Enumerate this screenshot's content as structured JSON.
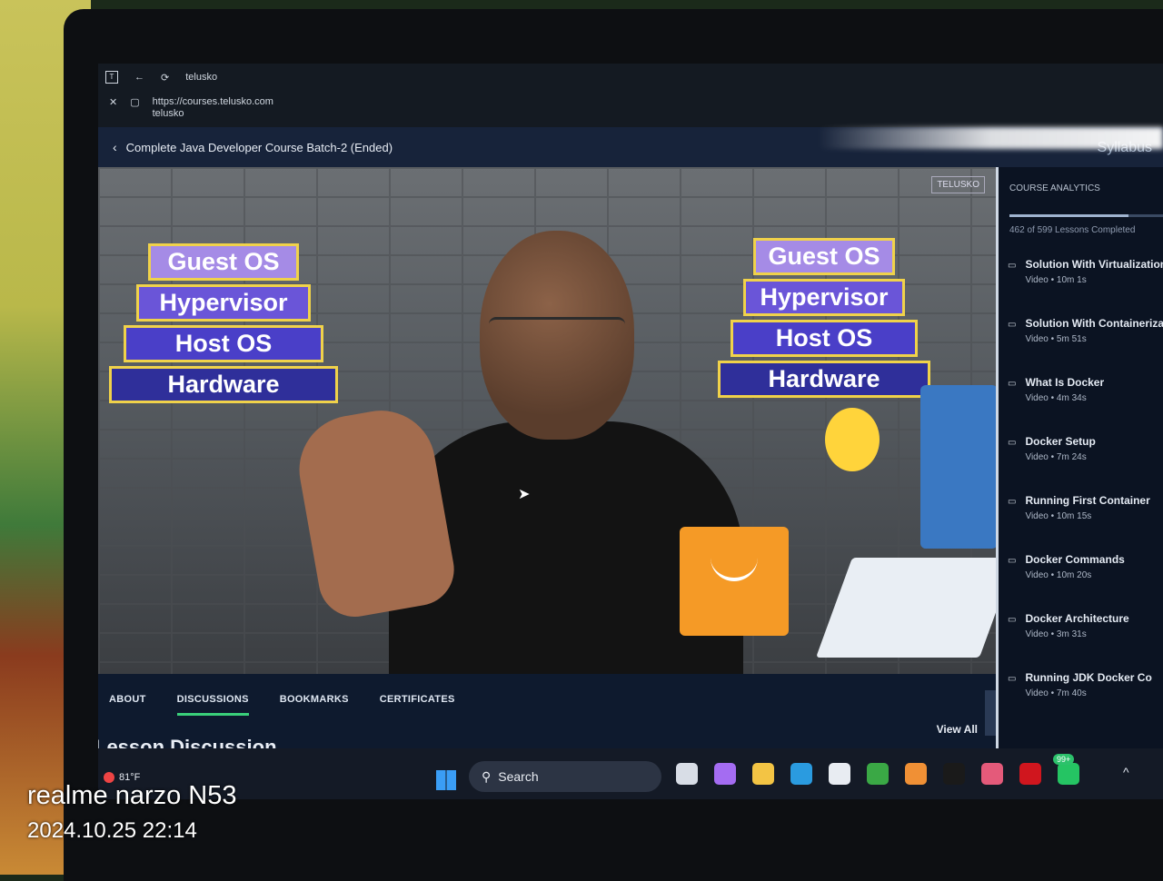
{
  "browser": {
    "tab_title": "telusko",
    "url": "https://courses.telusko.com",
    "site_name": "telusko"
  },
  "course": {
    "title": "Complete Java Developer Course Batch-2 (Ended)",
    "header_right": "Syllabus"
  },
  "video": {
    "watermark": "TELUSKO",
    "left_stack": [
      "Guest OS",
      "Hypervisor",
      "Host OS",
      "Hardware"
    ],
    "right_stack": [
      "Guest OS",
      "Hypervisor",
      "Host OS",
      "Hardware"
    ]
  },
  "tabs": [
    {
      "label": "ABOUT",
      "active": false
    },
    {
      "label": "DISCUSSIONS",
      "active": true
    },
    {
      "label": "BOOKMARKS",
      "active": false
    },
    {
      "label": "CERTIFICATES",
      "active": false
    }
  ],
  "discussion": {
    "title": "Lesson Discussion",
    "view_all": "View All"
  },
  "sidebar": {
    "section_label": "COURSE ANALYTICS",
    "progress_text": "462 of 599 Lessons Completed",
    "progress_fraction": 0.77,
    "lessons": [
      {
        "title": "Solution With Virtualization",
        "meta": "Video • 10m 1s"
      },
      {
        "title": "Solution With Containerizatio",
        "meta": "Video • 5m 51s"
      },
      {
        "title": "What Is Docker",
        "meta": "Video • 4m 34s"
      },
      {
        "title": "Docker Setup",
        "meta": "Video • 7m 24s"
      },
      {
        "title": "Running First Container",
        "meta": "Video • 10m 15s"
      },
      {
        "title": "Docker Commands",
        "meta": "Video • 10m 20s"
      },
      {
        "title": "Docker Architecture",
        "meta": "Video • 3m 31s"
      },
      {
        "title": "Running JDK Docker Co",
        "meta": "Video • 7m 40s"
      }
    ]
  },
  "taskbar": {
    "weather": "81°F",
    "search_label": "Search",
    "badge": "99+",
    "icons": [
      "task-view-icon",
      "copilot-icon",
      "file-explorer-icon",
      "edge-icon",
      "store-icon",
      "xbox-icon",
      "browser-icon",
      "telusko-app-icon",
      "app-icon",
      "netflix-icon",
      "whatsapp-icon"
    ],
    "icon_colors": [
      "#d8dde6",
      "#a46cf2",
      "#f3c444",
      "#2a9be0",
      "#e8ecf2",
      "#3aa845",
      "#f09035",
      "#1a1a1a",
      "#e45a7a",
      "#d0161e",
      "#25c463"
    ]
  },
  "camera": {
    "model": "realme narzo N53",
    "datetime": "2024.10.25 22:14"
  },
  "colors": {
    "layer_left": [
      "#a58be6",
      "#6a55d8",
      "#4a3fc8",
      "#2f2f9a"
    ],
    "layer_right": [
      "#a58be6",
      "#6a55d8",
      "#4a3fc8",
      "#2f2f9a"
    ],
    "accent_tab": "#3ad07a"
  }
}
